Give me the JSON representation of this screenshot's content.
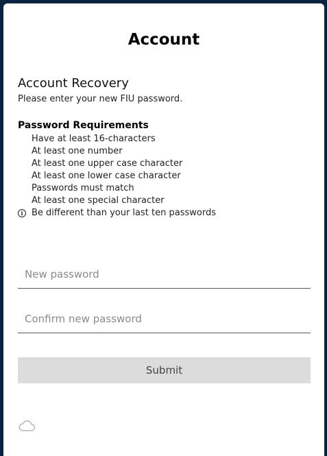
{
  "header": {
    "title": "Account"
  },
  "recovery": {
    "title": "Account Recovery",
    "instructions": "Please enter your new FIU password."
  },
  "requirements": {
    "heading": "Password Requirements",
    "items": [
      "Have at least 16-characters",
      "At least one number",
      "At least one upper case character",
      "At least one lower case character",
      "Passwords must match",
      "At least one special character",
      "Be different than your last ten passwords"
    ],
    "info_icon": "info-circle-icon"
  },
  "form": {
    "new_password_placeholder": "New password",
    "confirm_password_placeholder": "Confirm new password",
    "submit_label": "Submit"
  },
  "footer": {
    "icon": "cloud-icon"
  },
  "colors": {
    "background": "#0b2240",
    "card": "#ffffff",
    "submit_bg": "#dcdcdc"
  }
}
